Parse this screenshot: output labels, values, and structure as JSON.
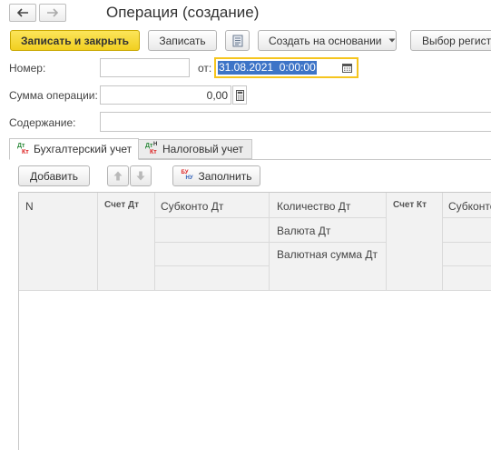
{
  "window": {
    "title": "Операция (создание)"
  },
  "nav": {
    "back_glyph": "🡐",
    "forward_glyph": "🡒"
  },
  "toolbar": {
    "save_close_label": "Записать и закрыть",
    "save_label": "Записать",
    "create_based_label": "Создать на основании",
    "select_register_label": "Выбор регист"
  },
  "form": {
    "number_label": "Номер:",
    "number_value": "",
    "date_label": "от:",
    "date_value": "31.08.2021  0:00:00",
    "amount_label": "Сумма операции:",
    "amount_value": "0,00",
    "content_label": "Содержание:",
    "content_value": ""
  },
  "tabs": [
    {
      "label": "Бухгалтерский учет",
      "active": true
    },
    {
      "label": "Налоговый учет",
      "active": false
    }
  ],
  "table_toolbar": {
    "add_label": "Добавить",
    "fill_label": "Заполнить"
  },
  "table": {
    "col_n": "N",
    "col_account_dt": "Счет Дт",
    "col_subconto_dt": "Субконто Дт",
    "col_qty_dt": "Количество Дт",
    "col_currency_dt": "Валюта Дт",
    "col_currency_sum_dt": "Валютная сумма Дт",
    "col_account_kt": "Счет Кт",
    "col_subconto_kt": "Субконто"
  },
  "colors": {
    "accent": "#f5d525",
    "date_selection": "#3d74c7",
    "tab_border": "#c8c8c8"
  }
}
